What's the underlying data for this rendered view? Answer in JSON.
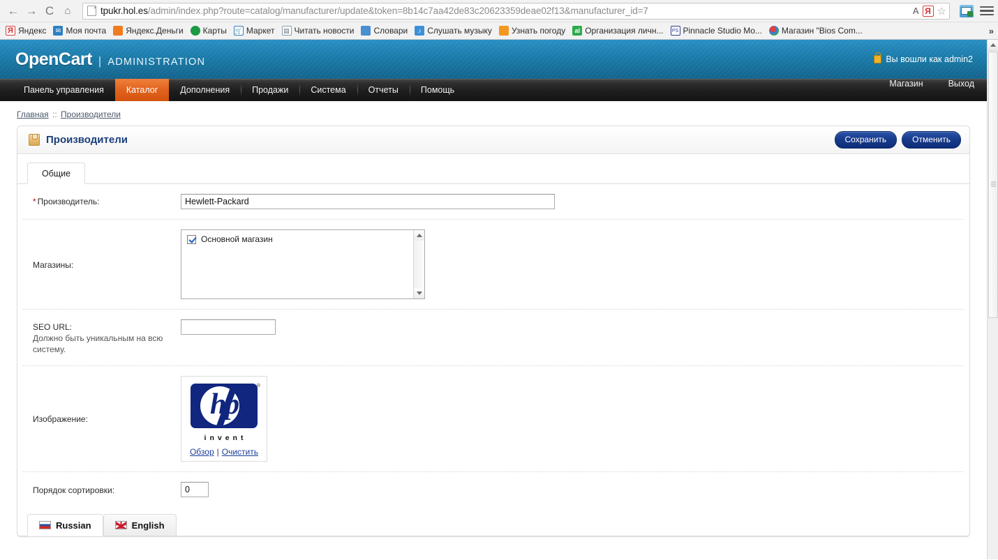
{
  "browser": {
    "back_icon": "back-arrow-icon",
    "forward_icon": "forward-arrow-icon",
    "reload_label": "C",
    "home_icon": "home-icon",
    "url_host": "tpukr.hol.es",
    "url_path": "/admin/index.php?route=catalog/manufacturer/update&token=8b14c7aa42de83c20623359deae02f13&manufacturer_id=7",
    "url_full": "tpukr.hol.es/admin/index.php?route=catalog/manufacturer/update&token=8b14c7aa42de83c20623359deae02f13&manufacturer_id=7",
    "translate_label": "A",
    "yandex_label": "Я",
    "star_label": "☆",
    "overflow_label": "»",
    "bookmarks": [
      {
        "label": "Яндекс",
        "icon": "yandex-icon",
        "icon_class": "bm-yandex",
        "glyph": "Я"
      },
      {
        "label": "Моя почта",
        "icon": "mail-icon",
        "icon_class": "bm-mail",
        "glyph": "✉"
      },
      {
        "label": "Яндекс.Деньги",
        "icon": "wallet-icon",
        "icon_class": "bm-money",
        "glyph": ""
      },
      {
        "label": "Карты",
        "icon": "maps-icon",
        "icon_class": "bm-maps",
        "glyph": ""
      },
      {
        "label": "Маркет",
        "icon": "cart-icon",
        "icon_class": "bm-market",
        "glyph": "🛒"
      },
      {
        "label": "Читать новости",
        "icon": "news-icon",
        "icon_class": "bm-news",
        "glyph": "▤"
      },
      {
        "label": "Словари",
        "icon": "dictionary-icon",
        "icon_class": "bm-dict",
        "glyph": ""
      },
      {
        "label": "Слушать музыку",
        "icon": "speaker-icon",
        "icon_class": "bm-music",
        "glyph": "♪"
      },
      {
        "label": "Узнать погоду",
        "icon": "weather-icon",
        "icon_class": "bm-weather",
        "glyph": ""
      },
      {
        "label": "Организация личн...",
        "icon": "organizer-icon",
        "icon_class": "bm-org",
        "glyph": "al"
      },
      {
        "label": "Pinnacle Studio Mo...",
        "icon": "pinnacle-icon",
        "icon_class": "bm-pinnacle",
        "glyph": "PS"
      },
      {
        "label": "Магазин \"Bios Com...",
        "icon": "shop-icon",
        "icon_class": "bm-bios",
        "glyph": ""
      }
    ]
  },
  "header": {
    "brand": "OpenCart",
    "separator": "|",
    "admin_label": "ADMINISTRATION",
    "user_status": "Вы вошли как admin2",
    "lock_icon": "lock-icon"
  },
  "nav": {
    "items": [
      {
        "label": "Панель управления",
        "active": false
      },
      {
        "label": "Каталог",
        "active": true
      },
      {
        "label": "Дополнения",
        "active": false
      },
      {
        "label": "Продажи",
        "active": false
      },
      {
        "label": "Система",
        "active": false
      },
      {
        "label": "Отчеты",
        "active": false
      },
      {
        "label": "Помощь",
        "active": false
      }
    ],
    "right_items": [
      {
        "label": "Магазин"
      },
      {
        "label": "Выход"
      }
    ]
  },
  "breadcrumb": {
    "home": "Главная",
    "separator": "::",
    "current": "Производители"
  },
  "panel": {
    "title": "Производители",
    "icon": "box-icon",
    "save_label": "Сохранить",
    "cancel_label": "Отменить",
    "tab_general": "Общие"
  },
  "form": {
    "manufacturer": {
      "required_mark": "*",
      "label": "Производитель:",
      "value": "Hewlett-Packard"
    },
    "stores": {
      "label": "Магазины:",
      "options": [
        {
          "label": "Основной магазин",
          "checked": true
        }
      ]
    },
    "seo_url": {
      "label": "SEO URL:",
      "hint": "Должно быть уникальным на всю систему.",
      "value": "",
      "placeholder": ""
    },
    "image": {
      "label": "Изображение:",
      "alt": "Hewlett-Packard invent logo",
      "logo_text": "hp",
      "logo_tagline": "invent",
      "logo_registered": "®",
      "browse_label": "Обзор",
      "separator": "|",
      "clear_label": "Очистить"
    },
    "sort_order": {
      "label": "Порядок сортировки:",
      "value": "0"
    }
  },
  "language_tabs": [
    {
      "label": "Russian",
      "flag": "flag-ru-icon",
      "active": true
    },
    {
      "label": "English",
      "flag": "flag-en-icon",
      "active": false
    }
  ],
  "colors": {
    "header_blue": "#1a7ba9",
    "nav_dark": "#1e1e1e",
    "accent_orange": "#e2651f",
    "button_blue": "#16398a",
    "title_blue": "#1a3f7a",
    "hp_blue": "#10267f",
    "required_red": "#cc0000"
  }
}
